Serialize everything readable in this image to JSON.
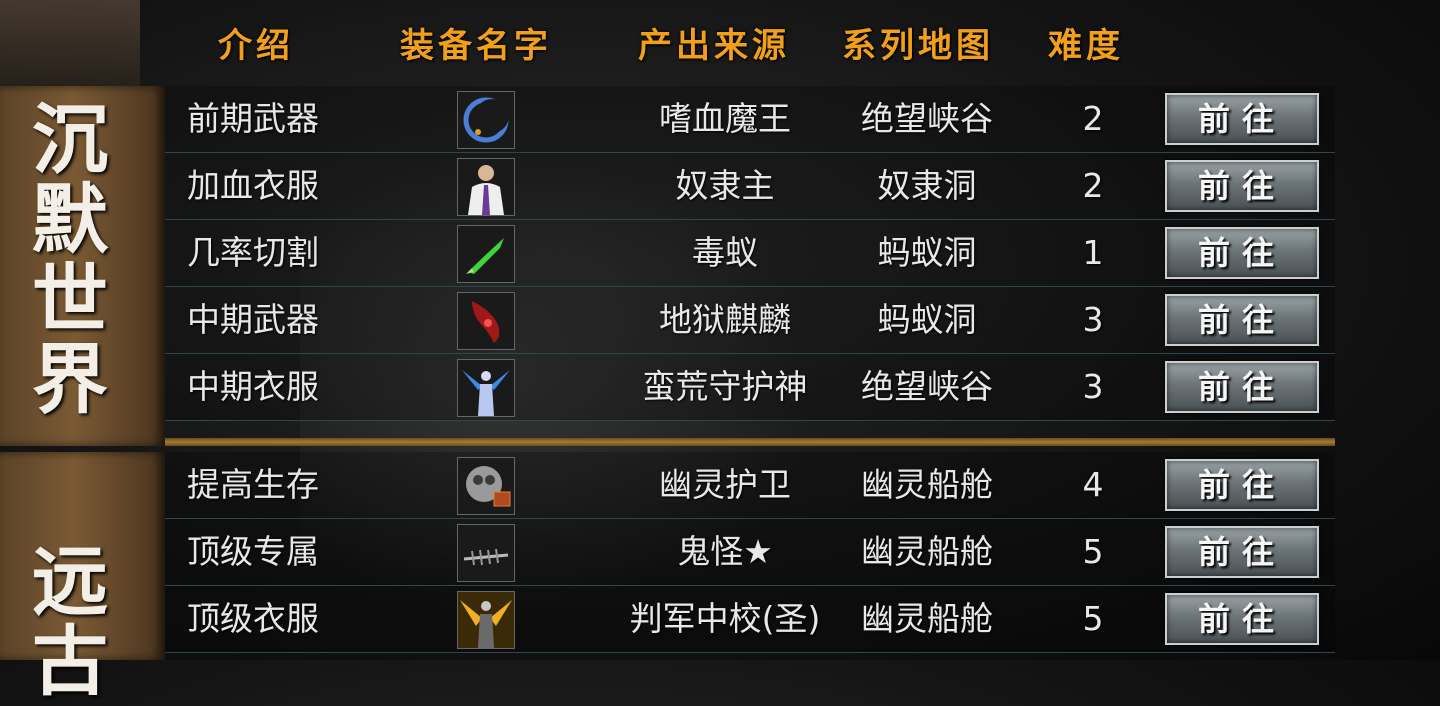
{
  "header": {
    "intro": "介绍",
    "name": "装备名字",
    "source": "产出来源",
    "map": "系列地图",
    "difficulty": "难度"
  },
  "sections": [
    {
      "title": "沉默世界",
      "rows": [
        {
          "intro": "前期武器",
          "icon": "moon-blade-icon",
          "source": "嗜血魔王",
          "map": "绝望峡谷",
          "difficulty": "2",
          "go": "前往"
        },
        {
          "intro": "加血衣服",
          "icon": "white-suit-armor-icon",
          "source": "奴隶主",
          "map": "奴隶洞",
          "difficulty": "2",
          "go": "前往"
        },
        {
          "intro": "几率切割",
          "icon": "green-blade-icon",
          "source": "毒蚁",
          "map": "蚂蚁洞",
          "difficulty": "1",
          "go": "前往"
        },
        {
          "intro": "中期武器",
          "icon": "red-crystal-blade-icon",
          "source": "地狱麒麟",
          "map": "蚂蚁洞",
          "difficulty": "3",
          "go": "前往"
        },
        {
          "intro": "中期衣服",
          "icon": "blue-winged-armor-icon",
          "source": "蛮荒守护神",
          "map": "绝望峡谷",
          "difficulty": "3",
          "go": "前往"
        }
      ]
    },
    {
      "title": "远古",
      "rows": [
        {
          "intro": "提高生存",
          "icon": "ghost-orb-icon",
          "source": "幽灵护卫",
          "map": "幽灵船舱",
          "difficulty": "4",
          "go": "前往"
        },
        {
          "intro": "顶级专属",
          "icon": "fishbone-blade-icon",
          "source": "鬼怪★",
          "map": "幽灵船舱",
          "difficulty": "5",
          "go": "前往"
        },
        {
          "intro": "顶级衣服",
          "icon": "golden-winged-armor-icon",
          "source": "判军中校(圣)",
          "map": "幽灵船舱",
          "difficulty": "5",
          "go": "前往"
        }
      ]
    }
  ],
  "colors": {
    "header_text": "#f2a01a",
    "banner": "#7a5a34",
    "row_text": "#e8e8e8"
  }
}
